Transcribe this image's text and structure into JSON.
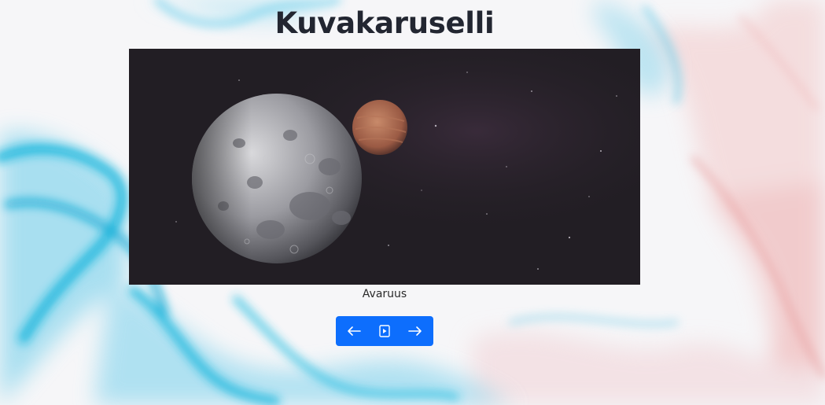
{
  "page": {
    "title": "Kuvakaruselli"
  },
  "carousel": {
    "caption": "Avaruus",
    "image_subject": "Kuu ja planeetta avaruudessa"
  },
  "controls": {
    "prev_icon": "arrow-left-icon",
    "play_icon": "play-icon",
    "next_icon": "arrow-right-icon",
    "accent_color": "#0d6efd"
  }
}
